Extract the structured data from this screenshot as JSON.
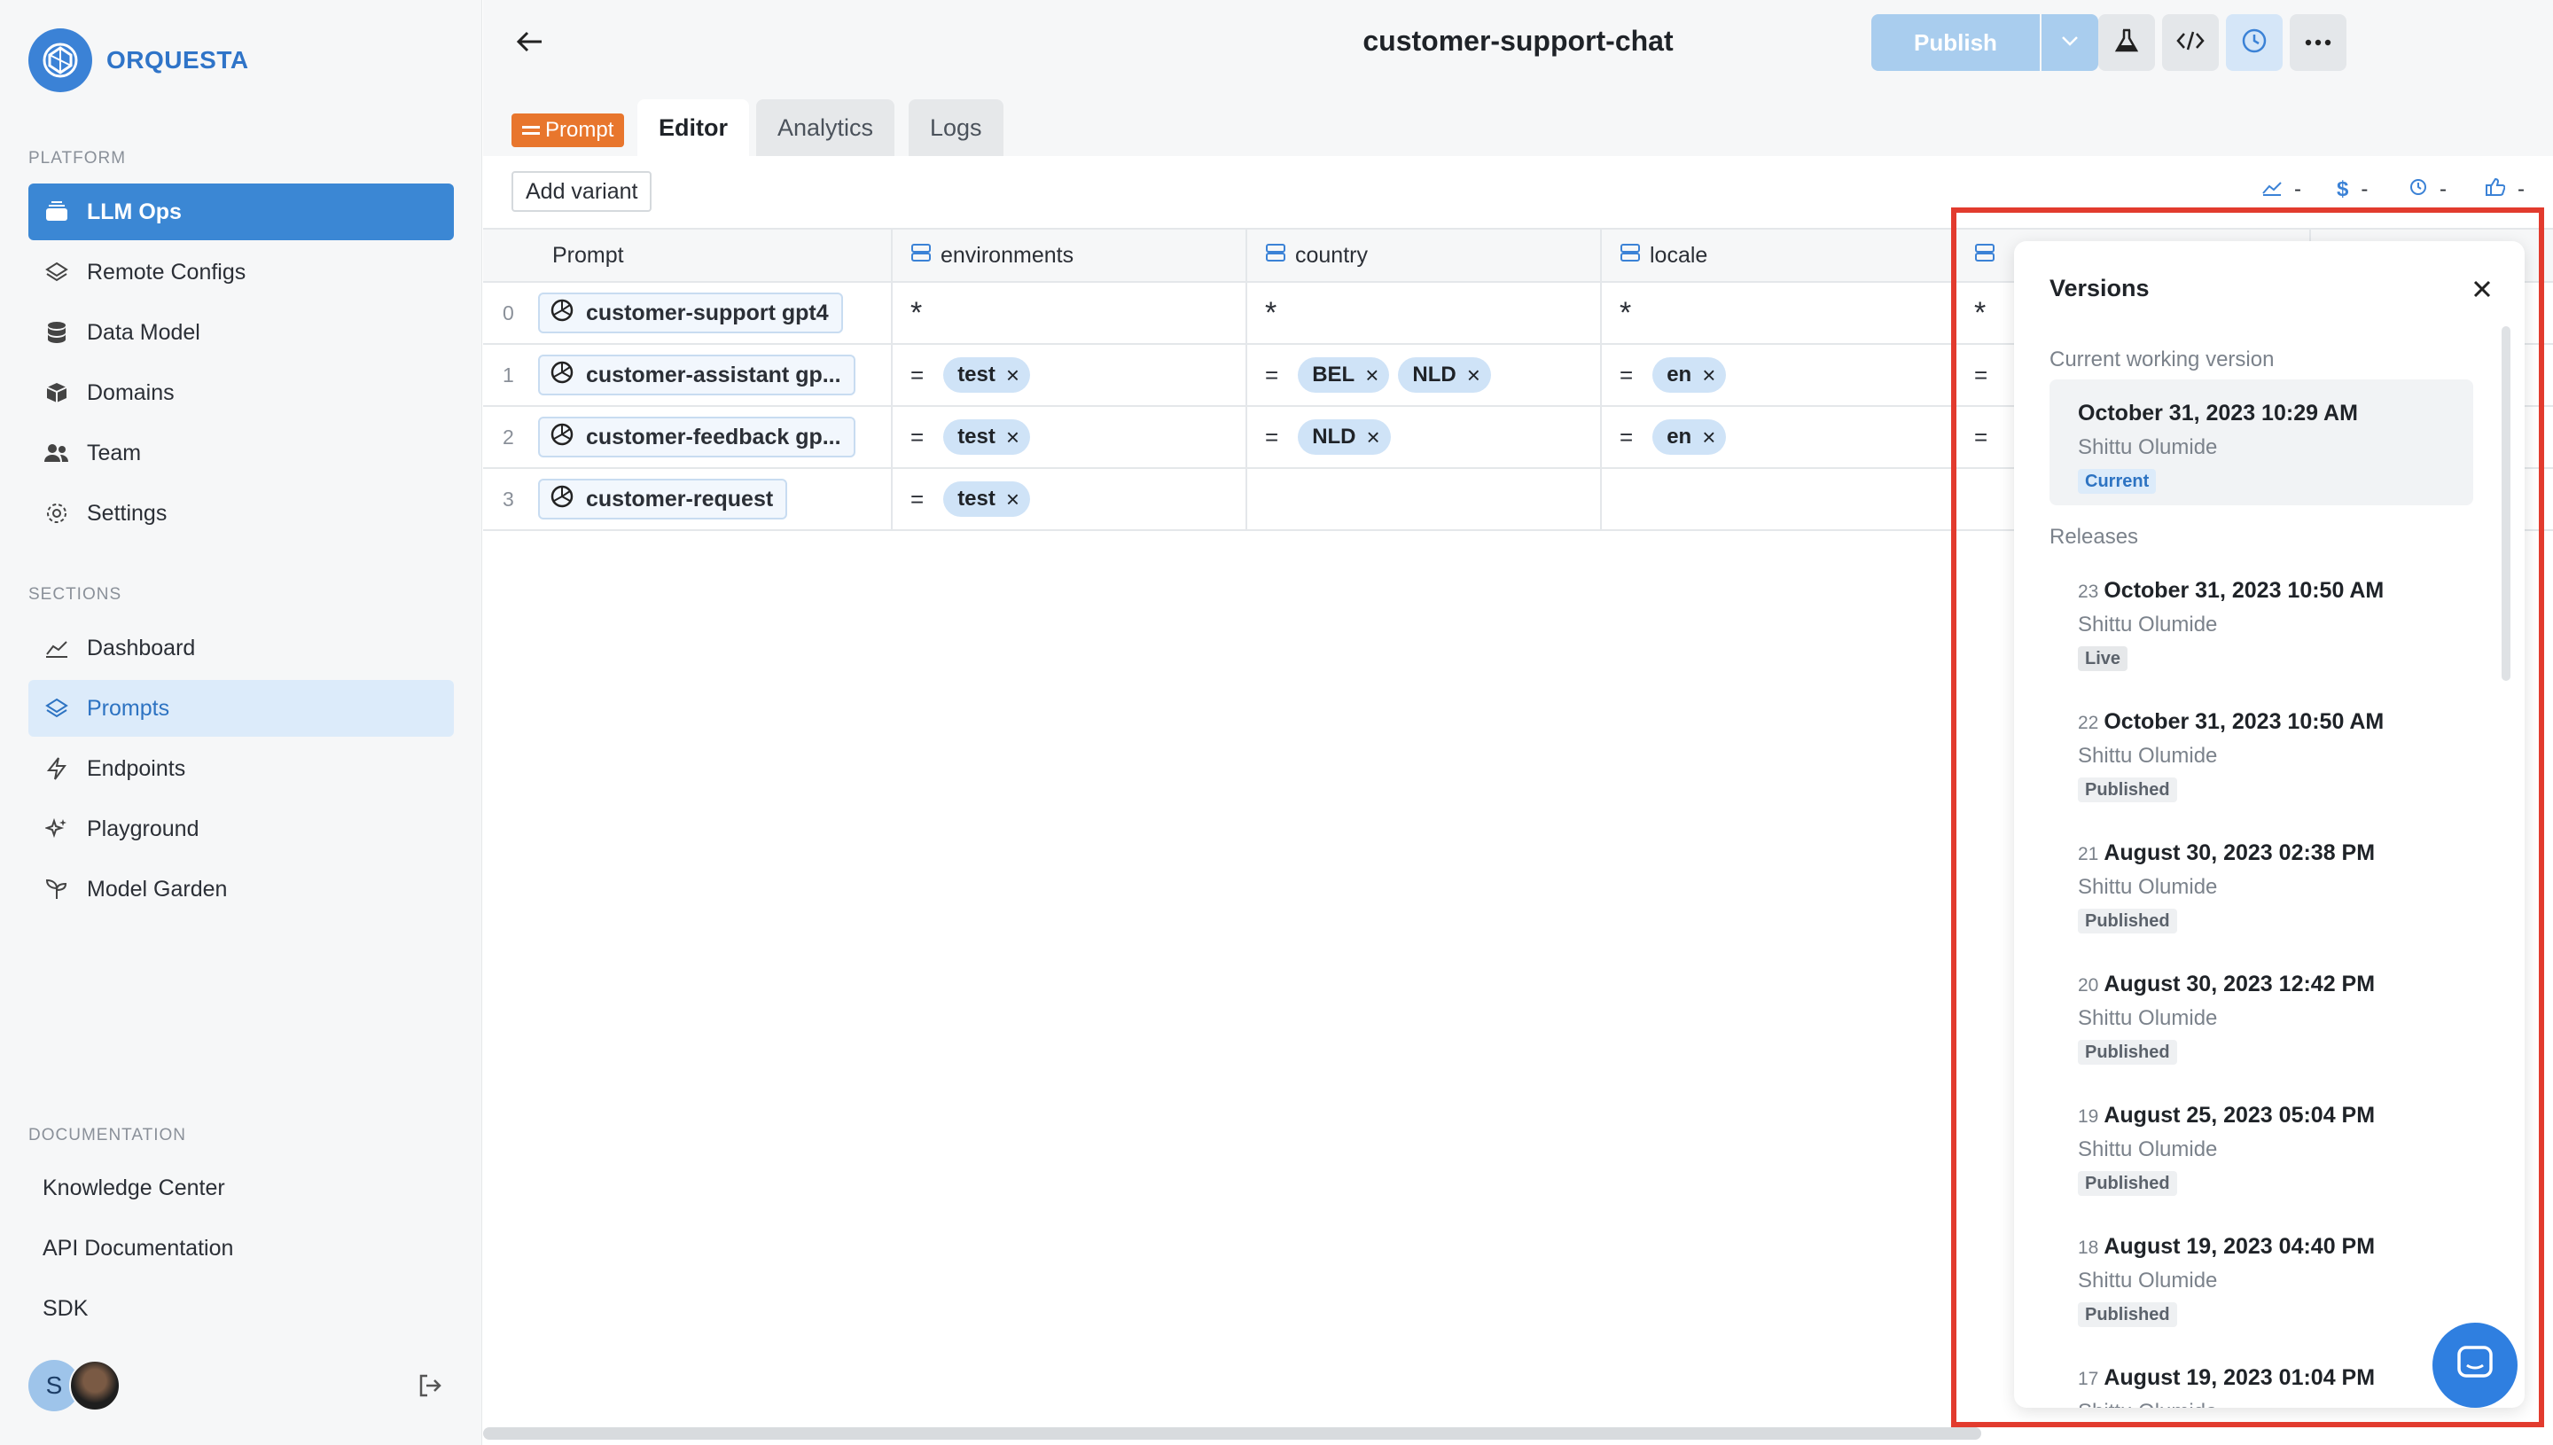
{
  "brand": {
    "name": "ORQUESTA"
  },
  "sidebar": {
    "platform_title": "PLATFORM",
    "platform_items": [
      {
        "label": "LLM Ops",
        "icon": "stack-icon"
      },
      {
        "label": "Remote Configs",
        "icon": "layers-icon"
      },
      {
        "label": "Data Model",
        "icon": "database-icon"
      },
      {
        "label": "Domains",
        "icon": "cube-icon"
      },
      {
        "label": "Team",
        "icon": "users-icon"
      },
      {
        "label": "Settings",
        "icon": "gear-icon"
      }
    ],
    "sections_title": "SECTIONS",
    "section_items": [
      {
        "label": "Dashboard",
        "icon": "chart-line-icon"
      },
      {
        "label": "Prompts",
        "icon": "layers-icon"
      },
      {
        "label": "Endpoints",
        "icon": "bolt-icon"
      },
      {
        "label": "Playground",
        "icon": "sparkles-icon"
      },
      {
        "label": "Model Garden",
        "icon": "sprout-icon"
      }
    ],
    "docs_title": "DOCUMENTATION",
    "doc_items": [
      "Knowledge Center",
      "API Documentation",
      "SDK"
    ],
    "avatar_initial": "S"
  },
  "header": {
    "title": "customer-support-chat",
    "publish_label": "Publish"
  },
  "tabs": {
    "prompt_tag": "Prompt",
    "items": [
      "Editor",
      "Analytics",
      "Logs"
    ]
  },
  "toolbar": {
    "add_variant": "Add variant",
    "metrics": [
      "-",
      "-",
      "-",
      "-"
    ]
  },
  "table": {
    "columns": [
      "Prompt",
      "environments",
      "country",
      "locale"
    ],
    "rows": [
      {
        "index": "0",
        "variant": "customer-support gpt4",
        "environments": "*",
        "country": "*",
        "locale": "*",
        "extra": "*"
      },
      {
        "index": "1",
        "variant": "customer-assistant gp...",
        "env_op": "=",
        "env_values": [
          "test"
        ],
        "country_op": "=",
        "country_values": [
          "BEL",
          "NLD"
        ],
        "locale_op": "=",
        "locale_values": [
          "en"
        ],
        "extra": "="
      },
      {
        "index": "2",
        "variant": "customer-feedback gp...",
        "env_op": "=",
        "env_values": [
          "test"
        ],
        "country_op": "=",
        "country_values": [
          "NLD"
        ],
        "locale_op": "=",
        "locale_values": [
          "en"
        ],
        "extra": "="
      },
      {
        "index": "3",
        "variant": "customer-request",
        "env_op": "=",
        "env_values": [
          "test"
        ]
      }
    ]
  },
  "versions": {
    "title": "Versions",
    "current_label": "Current working version",
    "current": {
      "date": "October 31, 2023 10:29 AM",
      "author": "Shittu Olumide",
      "badge": "Current"
    },
    "releases_label": "Releases",
    "releases": [
      {
        "num": "23",
        "date": "October 31, 2023 10:50 AM",
        "author": "Shittu Olumide",
        "badge": "Live"
      },
      {
        "num": "22",
        "date": "October 31, 2023 10:50 AM",
        "author": "Shittu Olumide",
        "badge": "Published"
      },
      {
        "num": "21",
        "date": "August 30, 2023 02:38 PM",
        "author": "Shittu Olumide",
        "badge": "Published"
      },
      {
        "num": "20",
        "date": "August 30, 2023 12:42 PM",
        "author": "Shittu Olumide",
        "badge": "Published"
      },
      {
        "num": "19",
        "date": "August 25, 2023 05:04 PM",
        "author": "Shittu Olumide",
        "badge": "Published"
      },
      {
        "num": "18",
        "date": "August 19, 2023 04:40 PM",
        "author": "Shittu Olumide",
        "badge": "Published"
      },
      {
        "num": "17",
        "date": "August 19, 2023 01:04 PM",
        "author": "Shittu Olumide"
      }
    ]
  },
  "colors": {
    "accent": "#3b87d4",
    "highlight": "#e23b2e",
    "prompt_tag": "#e8762d"
  }
}
